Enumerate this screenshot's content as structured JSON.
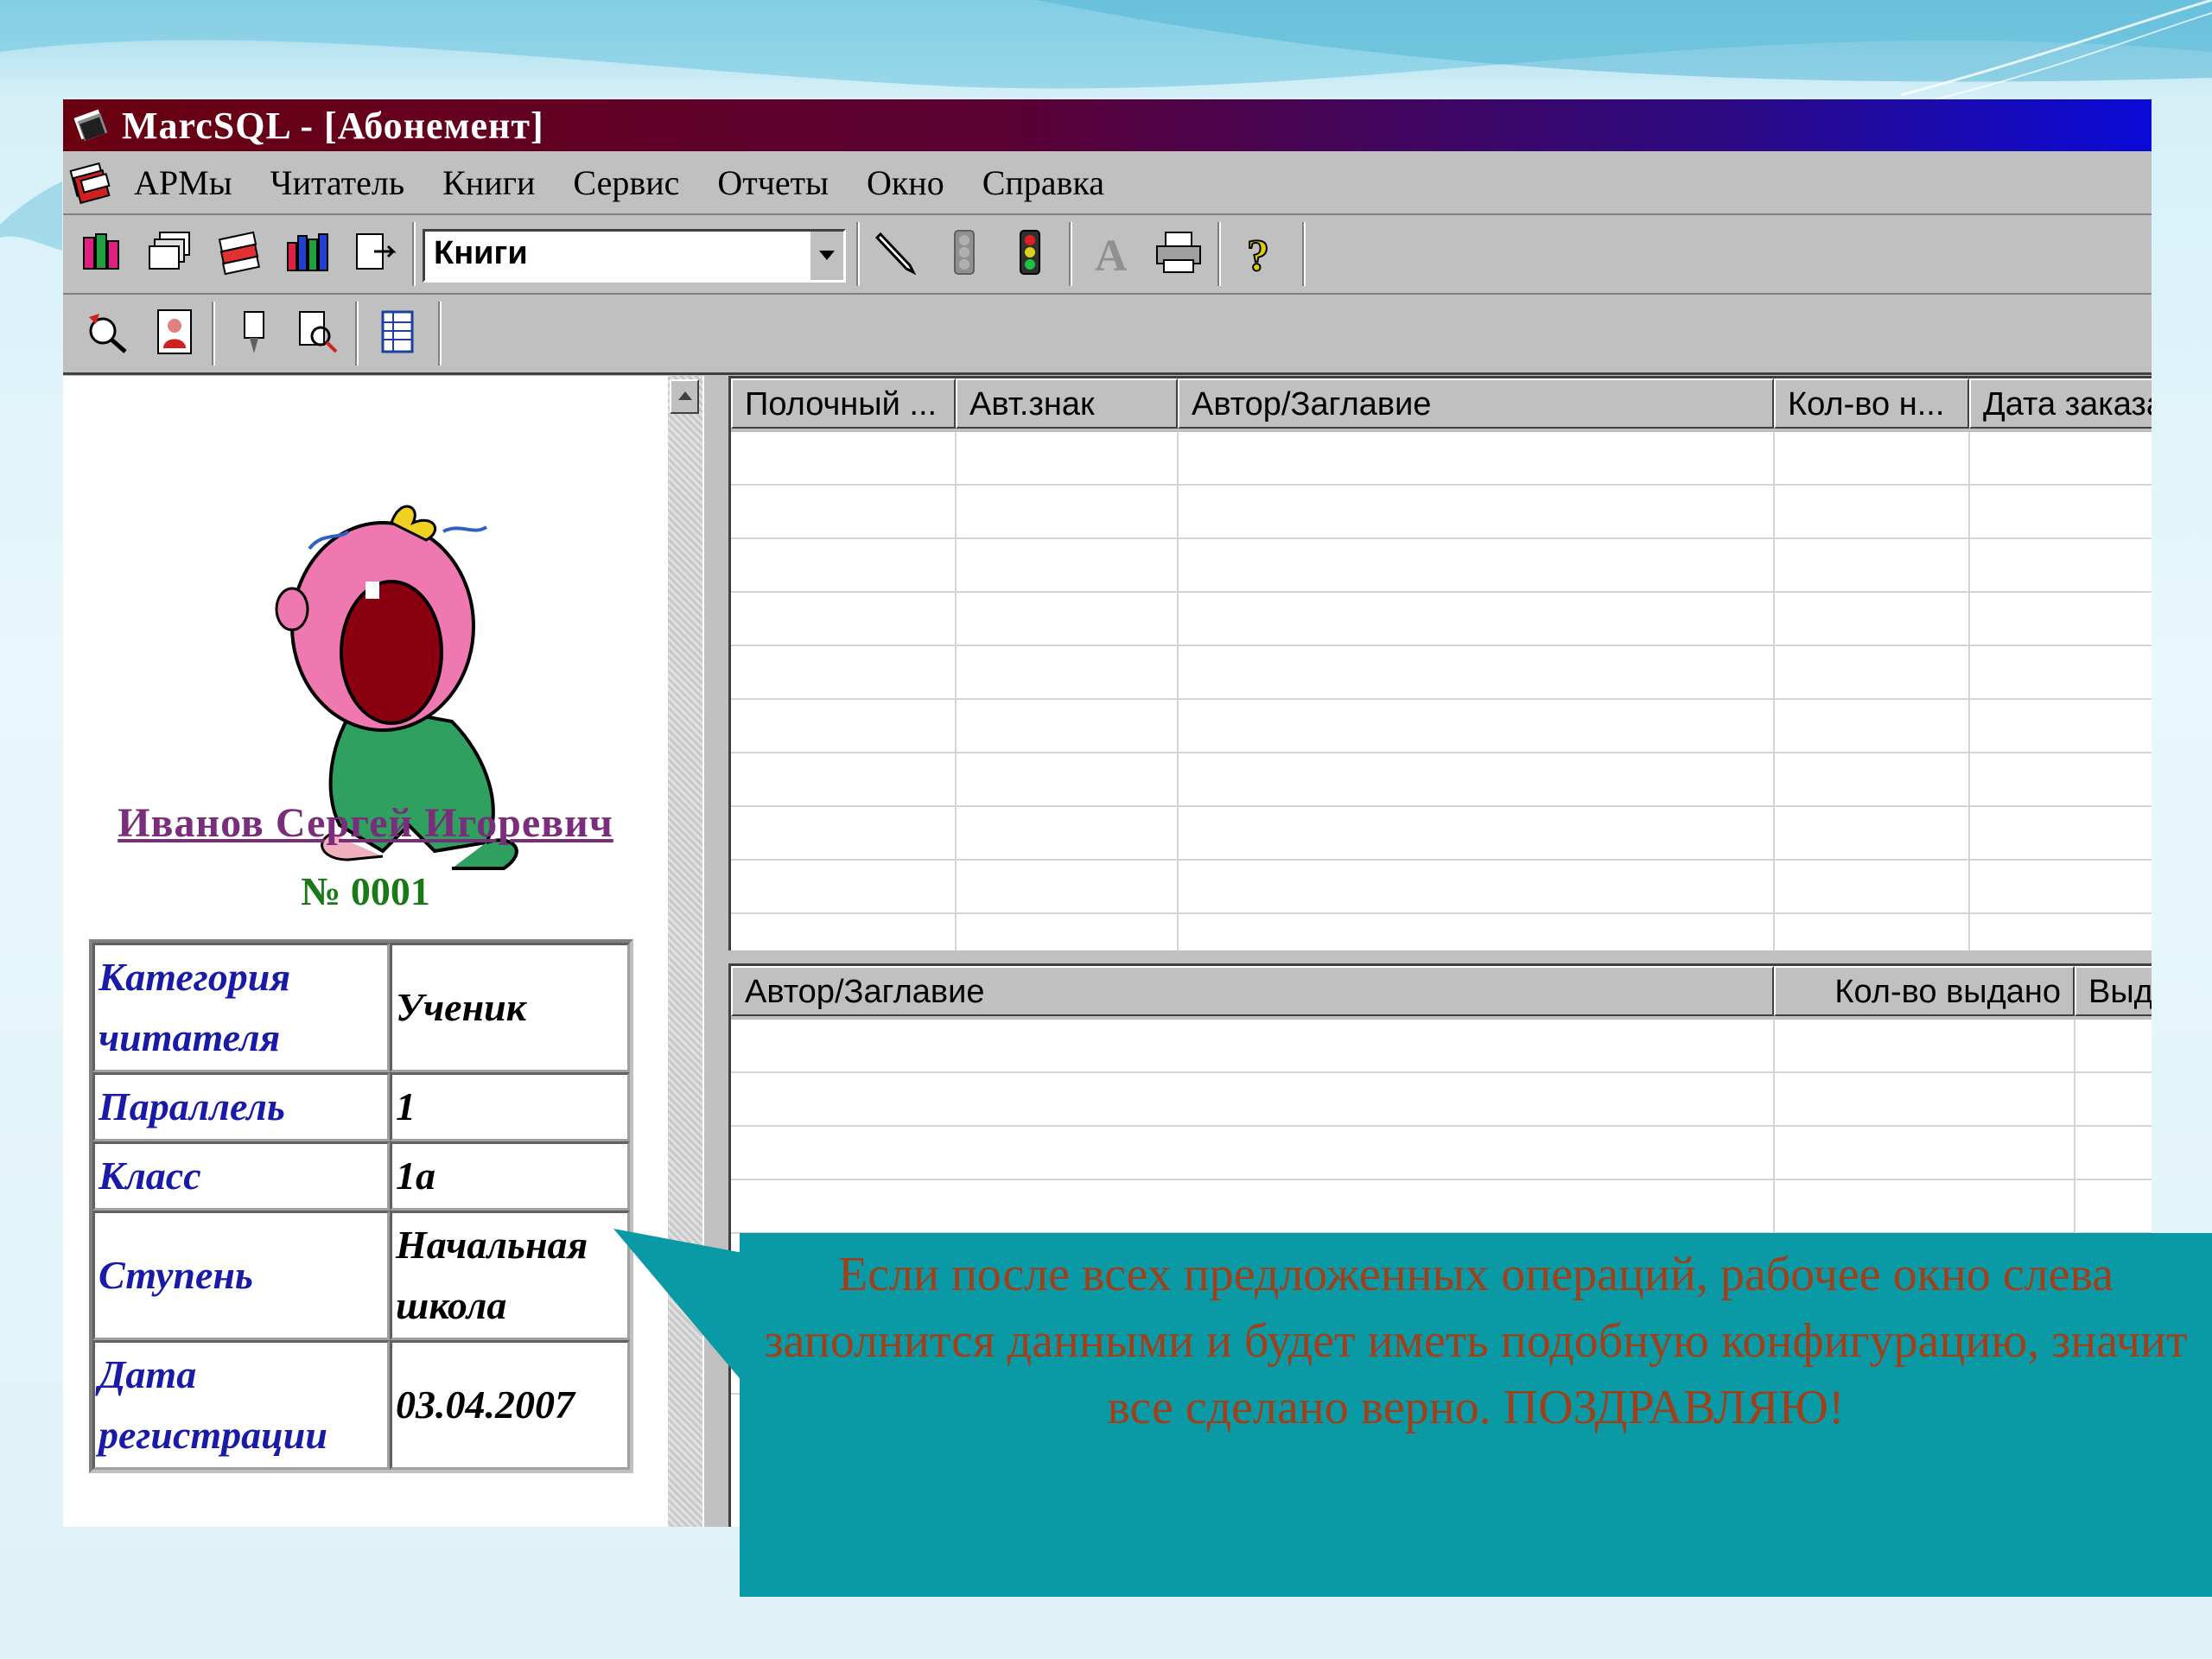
{
  "window": {
    "title": "MarcSQL - [Абонемент]"
  },
  "menu": {
    "items": [
      "АРМы",
      "Читатель",
      "Книги",
      "Сервис",
      "Отчеты",
      "Окно",
      "Справка"
    ]
  },
  "toolbar": {
    "combo_value": "Книги",
    "icons_row1": [
      "books-icon",
      "cards-icon",
      "stack-icon",
      "bookshelf-icon",
      "document-arrow-icon",
      "pen-icon",
      "traffic-light-off-icon",
      "traffic-light-icon",
      "text-style-icon",
      "printer-icon",
      "help-icon"
    ],
    "icons_row2": [
      "reader-search-icon",
      "reader-photo-icon",
      "bookmark-icon",
      "book-search-icon",
      "table-icon"
    ]
  },
  "reader": {
    "name": "Иванов Сергей Игоревич",
    "number": "№ 0001",
    "fields": [
      {
        "key": "Категория читателя",
        "value": "Ученик"
      },
      {
        "key": "Параллель",
        "value": "1"
      },
      {
        "key": "Класс",
        "value": "1а"
      },
      {
        "key": "Ступень",
        "value": "Начальная школа"
      },
      {
        "key": "Дата регистрации",
        "value": "03.04.2007"
      }
    ]
  },
  "grid_orders": {
    "columns": [
      "Полочный ...",
      "Авт.знак",
      "Автор/Заглавие",
      "Кол-во н...",
      "Дата заказа"
    ]
  },
  "grid_issued": {
    "columns": [
      "Автор/Заглавие",
      "Кол-во выдано",
      "Выдано"
    ]
  },
  "callout": {
    "text": "Если после всех предложенных операций, рабочее окно слева заполнится данными и будет иметь подобную конфигурацию, значит все сделано верно. ПОЗДРАВЛЯЮ!"
  },
  "colors": {
    "title_gradient_start": "#6a0010",
    "title_gradient_end": "#0a0ad8",
    "reader_name": "#7a2d7a",
    "reader_number": "#1a7a1a",
    "field_key": "#1a1aa8",
    "callout_bg": "#0a9aa6",
    "callout_text": "#a0401a"
  }
}
